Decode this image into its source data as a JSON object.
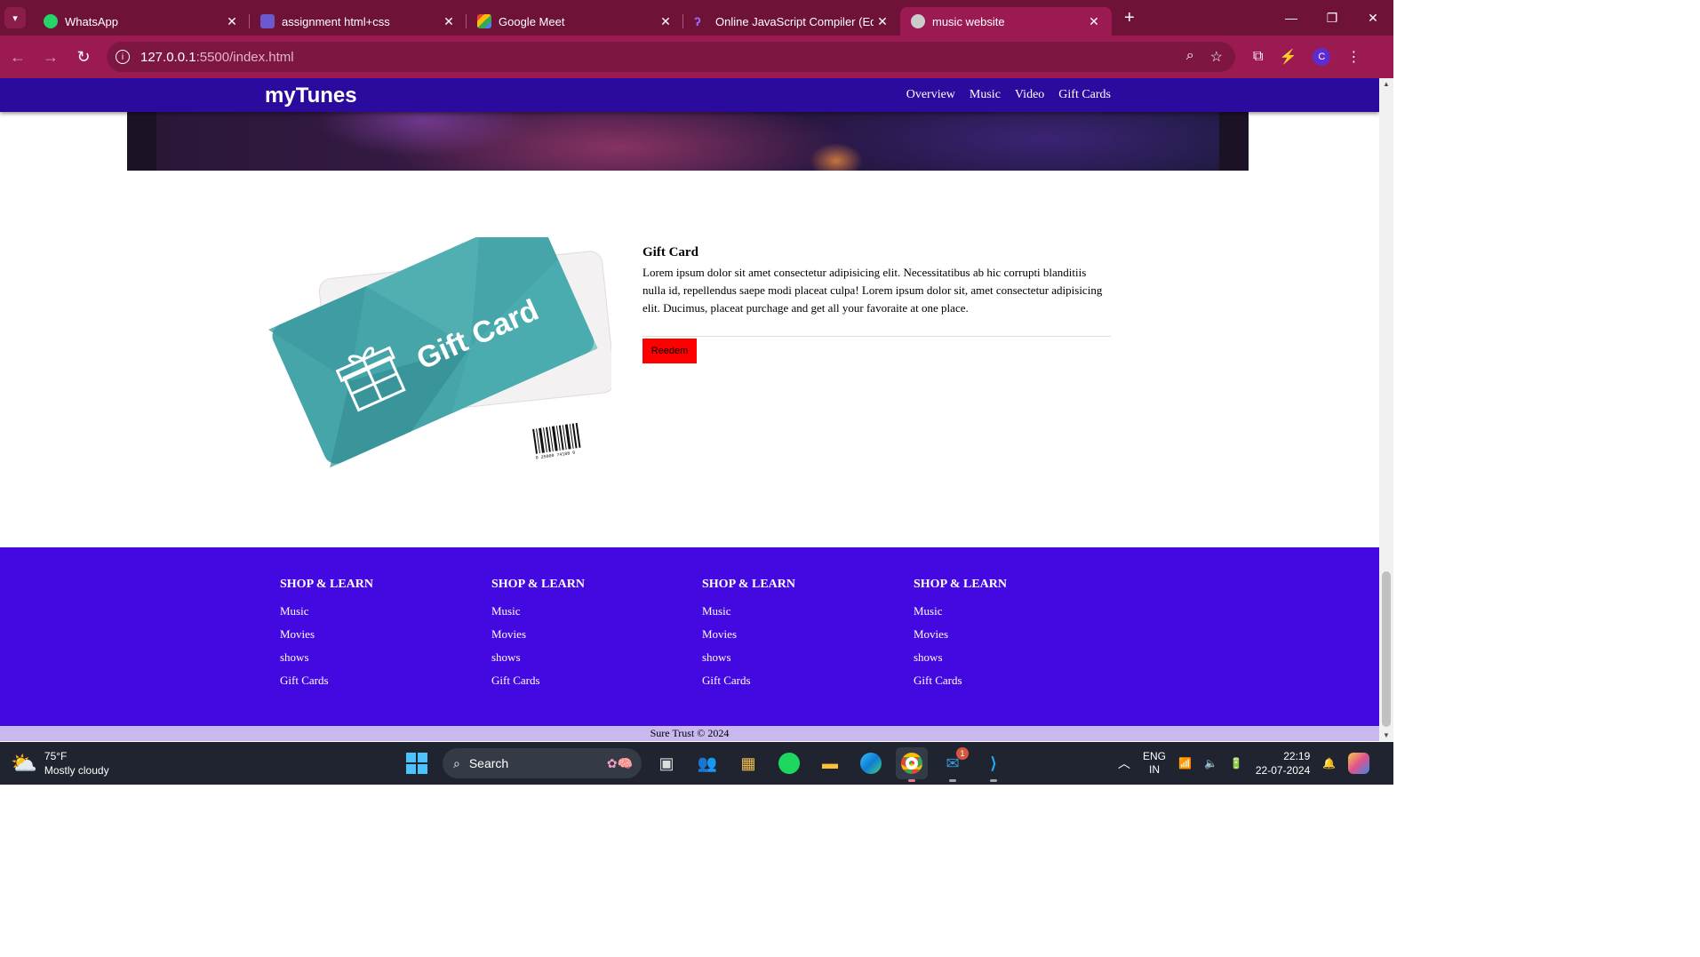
{
  "browser": {
    "tabs": [
      {
        "title": "WhatsApp",
        "icon": "whatsapp-icon",
        "color": "#25d366"
      },
      {
        "title": "assignment html+css",
        "icon": "document-icon",
        "color": "#6a5acd"
      },
      {
        "title": "Google Meet",
        "icon": "meet-icon",
        "color": "#00897b"
      },
      {
        "title": "Online JavaScript Compiler (Edi",
        "icon": "compiler-icon",
        "color": "#6c3bf5"
      },
      {
        "title": "music website",
        "icon": "globe-icon",
        "color": "#cccccc"
      }
    ],
    "url_host": "127.0.0.1",
    "url_rest": ":5500/index.html",
    "profile_initial": "C"
  },
  "site": {
    "logo": "myTunes",
    "nav": [
      "Overview",
      "Music",
      "Video",
      "Gift Cards"
    ]
  },
  "gift": {
    "image_label": "Gift Card",
    "barcode_number": "0 25000 74188 0",
    "title": "Gift Card",
    "description": "Lorem ipsum dolor sit amet consectetur adipisicing elit. Necessitatibus ab hic corrupti blanditiis nulla id, repellendus saepe modi placeat culpa! Lorem ipsum dolor sit, amet consectetur adipisicing elit. Ducimus, placeat purchage and get all your favoraite at one place.",
    "button": "Reedem"
  },
  "footer": {
    "columns": [
      {
        "heading": "SHOP & LEARN",
        "links": [
          "Music",
          "Movies",
          "shows",
          "Gift Cards"
        ]
      },
      {
        "heading": "SHOP & LEARN",
        "links": [
          "Music",
          "Movies",
          "shows",
          "Gift Cards"
        ]
      },
      {
        "heading": "SHOP & LEARN",
        "links": [
          "Music",
          "Movies",
          "shows",
          "Gift Cards"
        ]
      },
      {
        "heading": "SHOP & LEARN",
        "links": [
          "Music",
          "Movies",
          "shows",
          "Gift Cards"
        ]
      }
    ],
    "copyright": "Sure Trust © 2024"
  },
  "taskbar": {
    "temperature": "75°F",
    "weather": "Mostly cloudy",
    "search_placeholder": "Search",
    "language": "ENG",
    "region": "IN",
    "time": "22:19",
    "date": "22-07-2024",
    "mail_badge": "1"
  },
  "colors": {
    "site_nav": "#2b0a9e",
    "footer": "#4409e0",
    "button": "#ff0000",
    "browser_frame": "#9c1a52"
  }
}
